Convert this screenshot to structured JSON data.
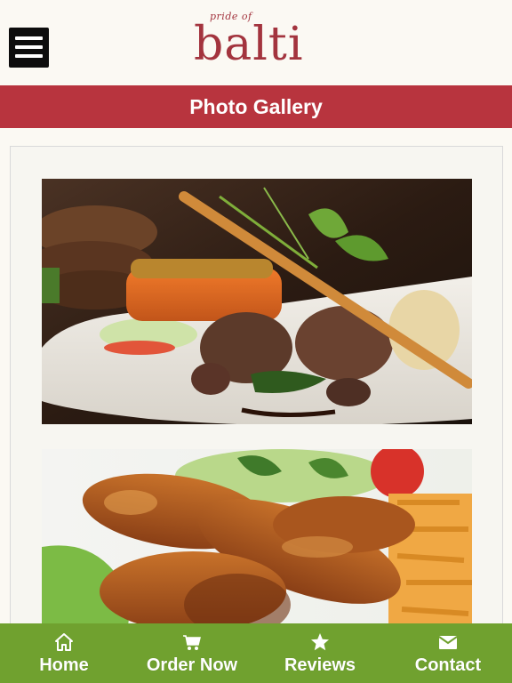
{
  "header": {
    "menu_icon": "hamburger-menu-icon",
    "logo_small": "pride of",
    "logo_main": "balti",
    "brand_color": "#a3343e"
  },
  "titlebar": {
    "title": "Photo Gallery",
    "color": "#b8343e"
  },
  "gallery": {
    "photos": [
      {
        "subject": "lamb chops with salmon and salad"
      },
      {
        "subject": "tandoori chicken drumsticks with fries and salad"
      }
    ]
  },
  "bottom_nav": {
    "color": "#70a12f",
    "items": [
      {
        "label": "Home",
        "icon": "home-icon"
      },
      {
        "label": "Order Now",
        "icon": "cart-icon"
      },
      {
        "label": "Reviews",
        "icon": "star-icon"
      },
      {
        "label": "Contact",
        "icon": "envelope-icon"
      }
    ]
  }
}
